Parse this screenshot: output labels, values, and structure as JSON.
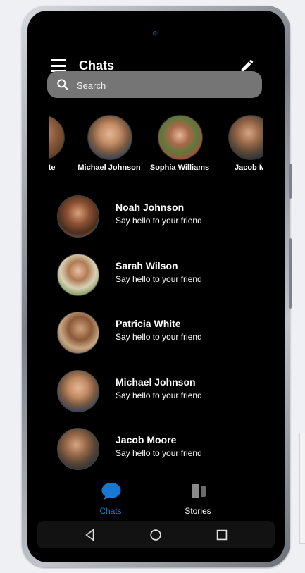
{
  "header": {
    "title": "Chats"
  },
  "search": {
    "placeholder": "Search"
  },
  "stories": [
    {
      "name": "Patricia White",
      "shown": "a White"
    },
    {
      "name": "Michael Johnson"
    },
    {
      "name": "Sophia Williams"
    },
    {
      "name": "Jacob Moore",
      "shown": "Jacob M"
    }
  ],
  "chats": [
    {
      "name": "Noah Johnson",
      "message": "Say hello to your friend"
    },
    {
      "name": "Sarah Wilson",
      "message": "Say hello to your friend"
    },
    {
      "name": "Patricia White",
      "message": "Say hello to your friend"
    },
    {
      "name": "Michael Johnson",
      "message": "Say hello to your friend"
    },
    {
      "name": "Jacob Moore",
      "message": "Say hello to your friend"
    }
  ],
  "tabs": {
    "chats": {
      "label": "Chats",
      "active": true
    },
    "stories": {
      "label": "Stories",
      "active": false
    }
  },
  "colors": {
    "accent": "#1877d2",
    "background": "#000000",
    "search_bg": "#757575"
  }
}
